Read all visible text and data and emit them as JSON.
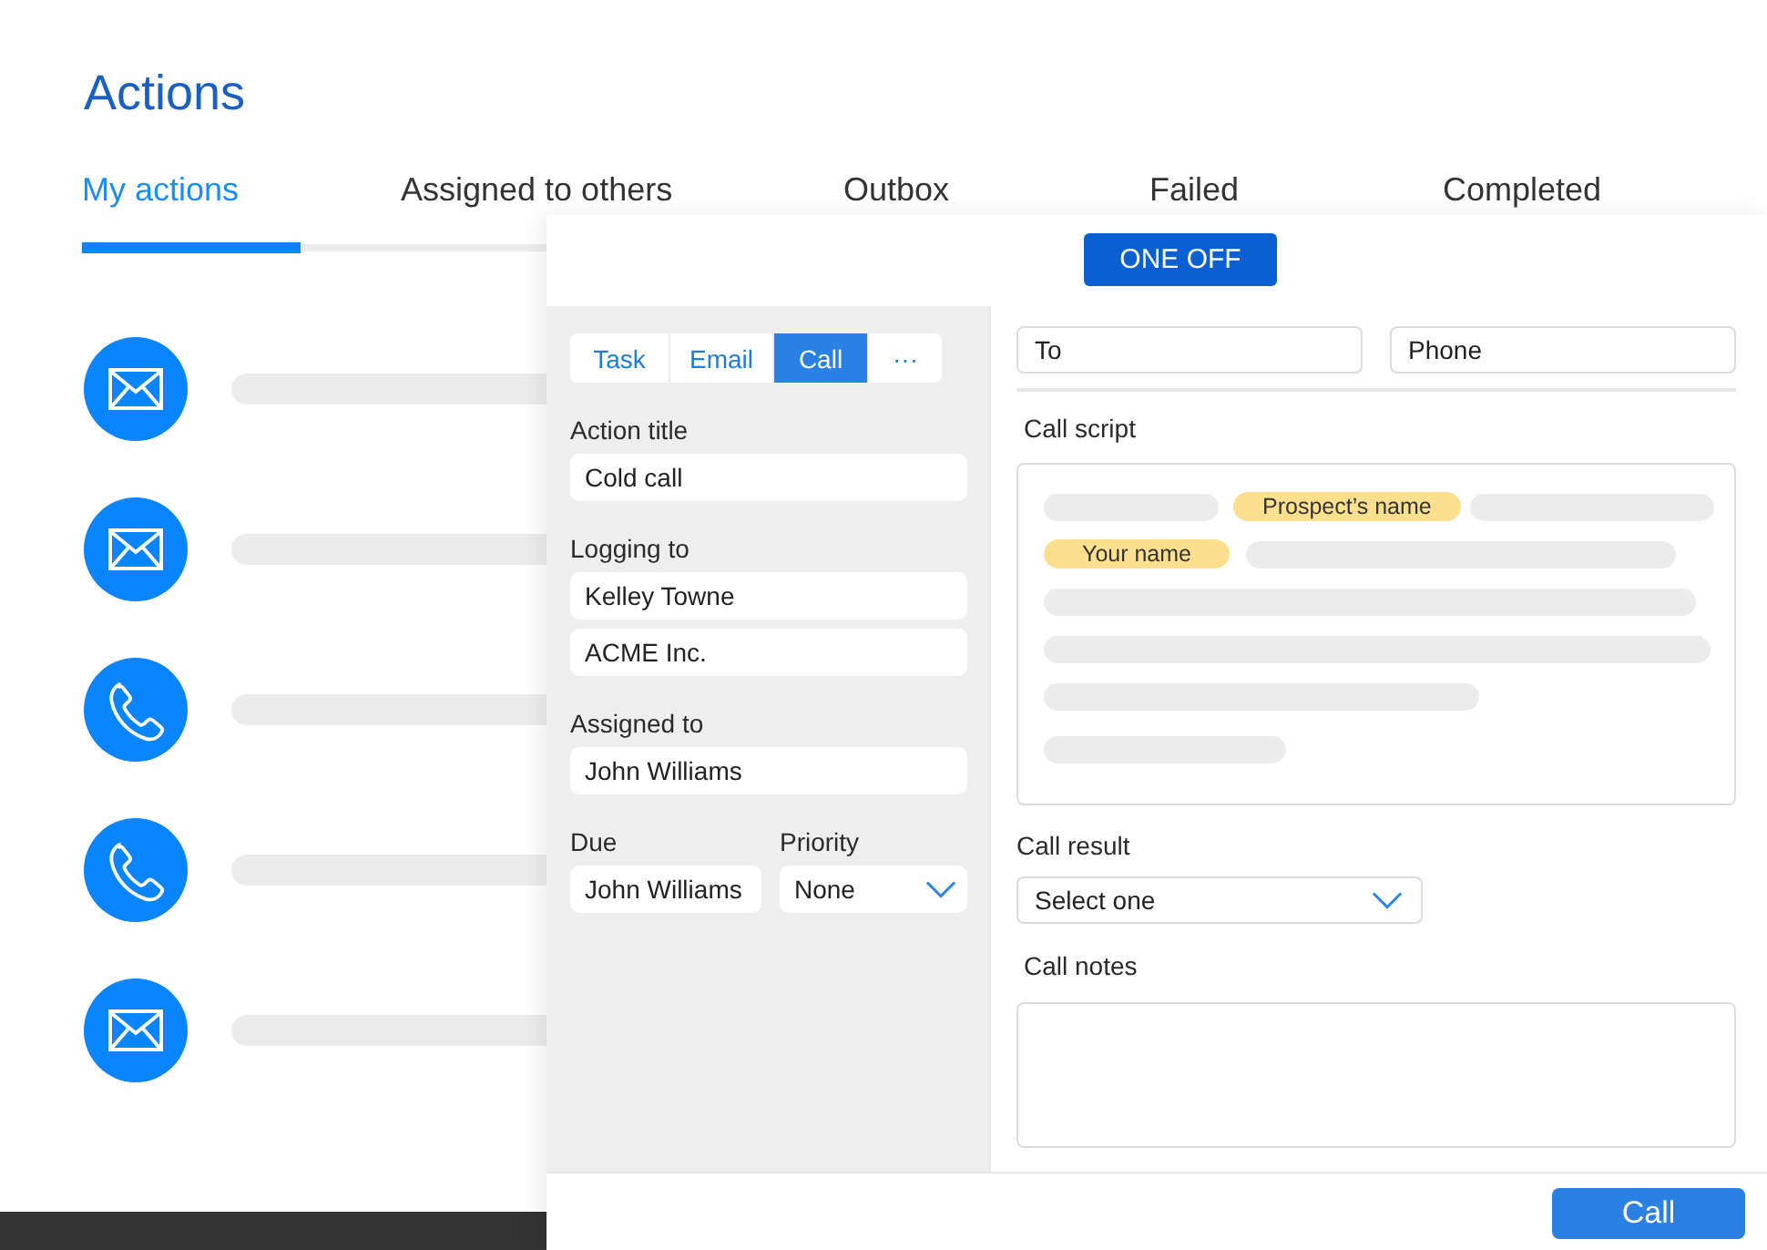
{
  "header": {
    "title": "Actions"
  },
  "tabs": [
    {
      "label": "My actions",
      "selected": true
    },
    {
      "label": "Assigned to others",
      "selected": false
    },
    {
      "label": "Outbox",
      "selected": false
    },
    {
      "label": "Failed",
      "selected": false
    },
    {
      "label": "Completed",
      "selected": false
    }
  ],
  "actions": [
    {
      "kind": "email"
    },
    {
      "kind": "email"
    },
    {
      "kind": "call"
    },
    {
      "kind": "call"
    },
    {
      "kind": "email"
    }
  ],
  "panel": {
    "mode_button": "ONE OFF",
    "type_tabs": [
      {
        "label": "Task",
        "selected": false
      },
      {
        "label": "Email",
        "selected": false
      },
      {
        "label": "Call",
        "selected": true
      },
      {
        "label": "···",
        "selected": false
      }
    ],
    "action_title": {
      "label": "Action title",
      "value": "Cold call"
    },
    "logging_to": {
      "label": "Logging to",
      "values": [
        "Kelley Towne",
        "ACME Inc."
      ]
    },
    "assigned_to": {
      "label": "Assigned to",
      "value": "John Williams"
    },
    "due": {
      "label": "Due",
      "value": "John Williams"
    },
    "priority": {
      "label": "Priority",
      "value": "None"
    },
    "to": {
      "placeholder": "To"
    },
    "phone": {
      "placeholder": "Phone"
    },
    "call_script": {
      "label": "Call script",
      "lines": [
        [
          {
            "kind": "blank"
          },
          {
            "kind": "field",
            "text": "Prospect’s name"
          },
          {
            "kind": "blank"
          }
        ],
        [
          {
            "kind": "field",
            "text": "Your name"
          },
          {
            "kind": "blank"
          }
        ],
        [
          {
            "kind": "blank"
          }
        ],
        [
          {
            "kind": "blank"
          }
        ],
        [
          {
            "kind": "blank"
          }
        ],
        [
          {
            "kind": "blank"
          }
        ]
      ]
    },
    "call_result": {
      "label": "Call result",
      "placeholder": "Select one"
    },
    "call_notes": {
      "label": "Call notes"
    },
    "submit_button": "Call"
  }
}
